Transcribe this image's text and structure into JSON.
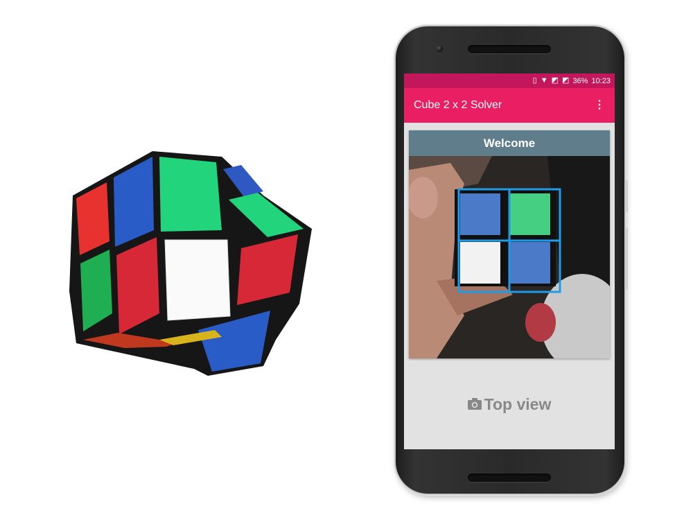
{
  "status_bar": {
    "battery": "36%",
    "time": "10:23",
    "icons": [
      "vibrate-icon",
      "wifi-icon",
      "no-signal-icon",
      "no-sim-icon"
    ]
  },
  "app_bar": {
    "title": "Cube 2 x 2 Solver",
    "menu_icon": "overflow-menu-icon"
  },
  "card": {
    "header": "Welcome",
    "grid_colors": [
      "blue",
      "green",
      "white",
      "blue"
    ]
  },
  "action": {
    "label": "Top view",
    "icon": "camera-icon"
  },
  "colors": {
    "status_bar": "#c2185b",
    "app_bar": "#e91e63",
    "card_header": "#607d8b",
    "grid_outline": "#1e9be9",
    "action_text": "#888888"
  }
}
